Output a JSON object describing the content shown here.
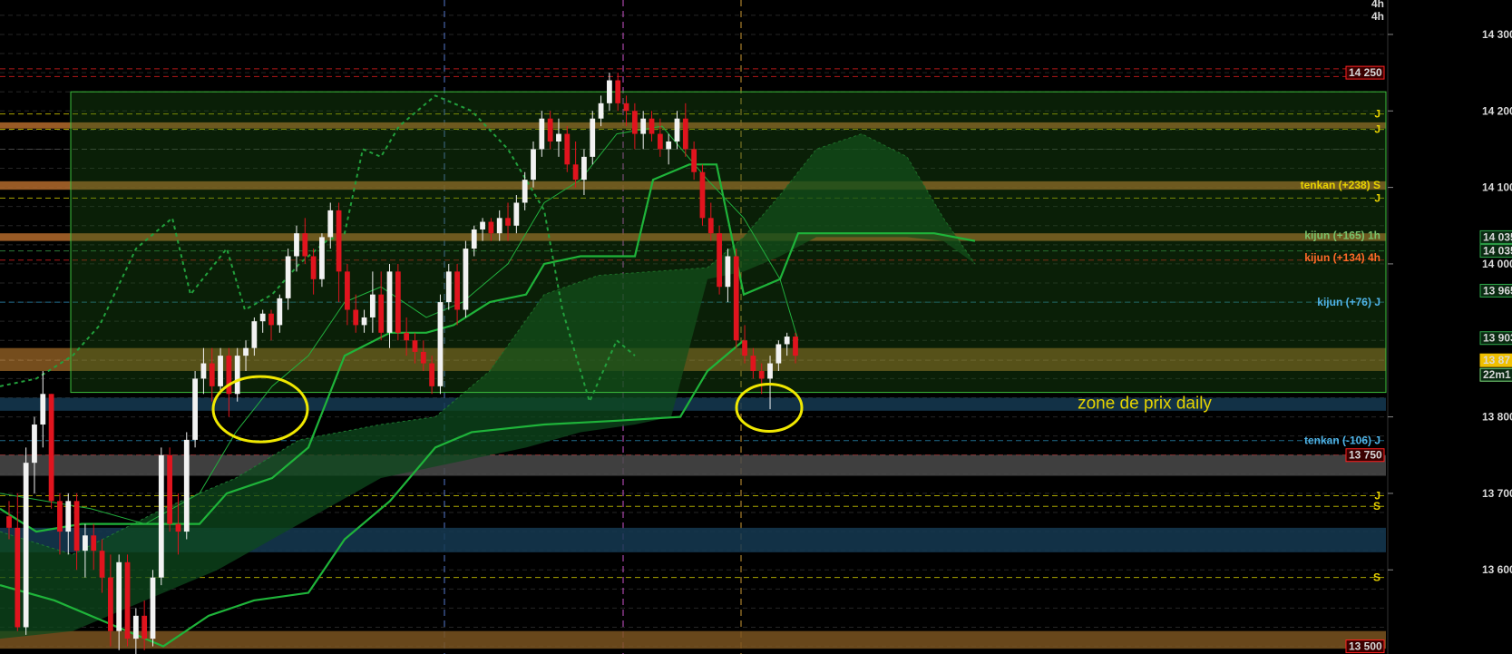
{
  "chart_data": {
    "type": "candlestick",
    "timeframe_labels": [
      "4h",
      "4h"
    ],
    "y_ticks": [
      "14 300",
      "14 200",
      "14 100",
      "14 000",
      "13 800",
      "13 700",
      "13 600"
    ],
    "ylim": [
      13490,
      14345
    ],
    "price_tags": [
      {
        "text": "14 250",
        "value": 14250,
        "color": "#ff2020"
      },
      {
        "text": "14 035",
        "value": 14035,
        "color": "#2ea84a"
      },
      {
        "text": "14 035",
        "value": 14017,
        "color": "#2ea84a"
      },
      {
        "text": "13 965",
        "value": 13965,
        "color": "#2ea84a"
      },
      {
        "text": "13 903",
        "value": 13903,
        "color": "#2ea84a"
      },
      {
        "text": "13 87",
        "value": 13874,
        "color": "#f0c000"
      },
      {
        "text": "22m1",
        "value": 13855,
        "color": "#7ee07e"
      },
      {
        "text": "13 750",
        "value": 13750,
        "color": "#ff2020"
      },
      {
        "text": "13 500",
        "value": 13500,
        "color": "#ff2020"
      }
    ],
    "indicator_labels": [
      {
        "text": "tenkan (+238) S",
        "value": 14103,
        "color": "#e8d200"
      },
      {
        "text": "kijun (+165) 1h",
        "value": 14037,
        "color": "#7ac26b"
      },
      {
        "text": "kijun (+134) 4h",
        "value": 14008,
        "color": "#ff6a28"
      },
      {
        "text": "kijun (+76) J",
        "value": 13950,
        "color": "#4fb4e8"
      },
      {
        "text": "tenkan (-106) J",
        "value": 13769,
        "color": "#4fb4e8"
      }
    ],
    "level_markers": [
      {
        "text": "J",
        "value": 14196,
        "color": "#e8d200"
      },
      {
        "text": "J",
        "value": 14176,
        "color": "#e8d200"
      },
      {
        "text": "J",
        "value": 14086,
        "color": "#e8d200"
      },
      {
        "text": "J",
        "value": 13697,
        "color": "#e8d200"
      },
      {
        "text": "S",
        "value": 13683,
        "color": "#e8d200"
      },
      {
        "text": "S",
        "value": 13590,
        "color": "#e8d200"
      }
    ],
    "bands": [
      {
        "from": 14177,
        "to": 14185,
        "color": "#b36a2c"
      },
      {
        "from": 14097,
        "to": 14108,
        "color": "#b36a2c"
      },
      {
        "from": 14030,
        "to": 14040,
        "color": "#b36a2c"
      },
      {
        "from": 13860,
        "to": 13890,
        "color": "#8a5a22"
      },
      {
        "from": 13808,
        "to": 13825,
        "color": "#153a52"
      },
      {
        "from": 13723,
        "to": 13750,
        "color": "#4a4a4a"
      },
      {
        "from": 13623,
        "to": 13655,
        "color": "#153a52"
      },
      {
        "from": 13497,
        "to": 13520,
        "color": "#7a5420"
      }
    ],
    "daily_zone": {
      "label": "zone de prix daily",
      "from": 13832,
      "to": 14225,
      "x_start": 0.05
    },
    "candles": [
      [
        13670,
        13690,
        13640,
        13655
      ],
      [
        13655,
        13700,
        13520,
        13525
      ],
      [
        13525,
        13760,
        13515,
        13740
      ],
      [
        13740,
        13800,
        13700,
        13790
      ],
      [
        13790,
        13860,
        13760,
        13830
      ],
      [
        13830,
        13830,
        13680,
        13690
      ],
      [
        13690,
        13700,
        13620,
        13650
      ],
      [
        13650,
        13700,
        13620,
        13690
      ],
      [
        13690,
        13700,
        13600,
        13625
      ],
      [
        13625,
        13660,
        13590,
        13645
      ],
      [
        13645,
        13660,
        13600,
        13625
      ],
      [
        13625,
        13640,
        13570,
        13590
      ],
      [
        13590,
        13620,
        13500,
        13520
      ],
      [
        13520,
        13620,
        13495,
        13610
      ],
      [
        13610,
        13620,
        13500,
        13510
      ],
      [
        13510,
        13550,
        13490,
        13540
      ],
      [
        13540,
        13560,
        13495,
        13510
      ],
      [
        13510,
        13600,
        13500,
        13590
      ],
      [
        13590,
        13760,
        13580,
        13750
      ],
      [
        13750,
        13760,
        13650,
        13660
      ],
      [
        13660,
        13700,
        13620,
        13650
      ],
      [
        13650,
        13780,
        13640,
        13770
      ],
      [
        13770,
        13860,
        13760,
        13850
      ],
      [
        13850,
        13890,
        13830,
        13870
      ],
      [
        13870,
        13890,
        13820,
        13840
      ],
      [
        13840,
        13890,
        13830,
        13880
      ],
      [
        13880,
        13890,
        13800,
        13830
      ],
      [
        13830,
        13890,
        13820,
        13880
      ],
      [
        13880,
        13900,
        13860,
        13890
      ],
      [
        13890,
        13930,
        13880,
        13925
      ],
      [
        13925,
        13940,
        13910,
        13935
      ],
      [
        13935,
        13940,
        13900,
        13920
      ],
      [
        13920,
        13960,
        13910,
        13955
      ],
      [
        13955,
        14020,
        13940,
        14010
      ],
      [
        14010,
        14050,
        13990,
        14040
      ],
      [
        14040,
        14060,
        14000,
        14010
      ],
      [
        14010,
        14020,
        13960,
        13980
      ],
      [
        13980,
        14040,
        13970,
        14035
      ],
      [
        14035,
        14080,
        14020,
        14070
      ],
      [
        14070,
        14080,
        13950,
        13990
      ],
      [
        13990,
        14000,
        13920,
        13940
      ],
      [
        13940,
        13960,
        13910,
        13920
      ],
      [
        13920,
        13940,
        13910,
        13930
      ],
      [
        13930,
        13990,
        13910,
        13960
      ],
      [
        13960,
        13990,
        13900,
        13910
      ],
      [
        13910,
        14000,
        13890,
        13990
      ],
      [
        13990,
        14000,
        13900,
        13910
      ],
      [
        13910,
        13930,
        13880,
        13900
      ],
      [
        13900,
        13910,
        13870,
        13885
      ],
      [
        13885,
        13900,
        13860,
        13870
      ],
      [
        13870,
        13880,
        13830,
        13840
      ],
      [
        13840,
        13960,
        13830,
        13950
      ],
      [
        13950,
        14000,
        13940,
        13990
      ],
      [
        13990,
        14000,
        13920,
        13940
      ],
      [
        13940,
        14030,
        13930,
        14020
      ],
      [
        14020,
        14050,
        14010,
        14045
      ],
      [
        14045,
        14060,
        14030,
        14055
      ],
      [
        14055,
        14060,
        14030,
        14040
      ],
      [
        14040,
        14070,
        14030,
        14060
      ],
      [
        14060,
        14080,
        14030,
        14050
      ],
      [
        14050,
        14090,
        14040,
        14080
      ],
      [
        14080,
        14120,
        14070,
        14110
      ],
      [
        14110,
        14160,
        14100,
        14150
      ],
      [
        14150,
        14200,
        14140,
        14190
      ],
      [
        14190,
        14200,
        14150,
        14160
      ],
      [
        14160,
        14190,
        14140,
        14170
      ],
      [
        14170,
        14180,
        14120,
        14130
      ],
      [
        14130,
        14160,
        14100,
        14110
      ],
      [
        14110,
        14150,
        14090,
        14140
      ],
      [
        14140,
        14200,
        14130,
        14190
      ],
      [
        14190,
        14220,
        14180,
        14210
      ],
      [
        14210,
        14250,
        14200,
        14240
      ],
      [
        14240,
        14250,
        14200,
        14210
      ],
      [
        14210,
        14220,
        14180,
        14200
      ],
      [
        14200,
        14210,
        14150,
        14170
      ],
      [
        14170,
        14200,
        14150,
        14190
      ],
      [
        14190,
        14200,
        14160,
        14170
      ],
      [
        14170,
        14190,
        14140,
        14150
      ],
      [
        14150,
        14170,
        14130,
        14160
      ],
      [
        14160,
        14200,
        14150,
        14190
      ],
      [
        14190,
        14210,
        14140,
        14150
      ],
      [
        14150,
        14160,
        14110,
        14120
      ],
      [
        14120,
        14130,
        14050,
        14060
      ],
      [
        14060,
        14080,
        14030,
        14040
      ],
      [
        14040,
        14050,
        13960,
        13970
      ],
      [
        13970,
        14020,
        13950,
        14010
      ],
      [
        14010,
        14020,
        13890,
        13900
      ],
      [
        13900,
        13920,
        13870,
        13880
      ],
      [
        13880,
        13890,
        13850,
        13860
      ],
      [
        13860,
        13870,
        13830,
        13850
      ],
      [
        13850,
        13880,
        13810,
        13870
      ],
      [
        13870,
        13900,
        13860,
        13895
      ],
      [
        13895,
        13910,
        13880,
        13905
      ],
      [
        13905,
        13910,
        13870,
        13880
      ]
    ]
  }
}
